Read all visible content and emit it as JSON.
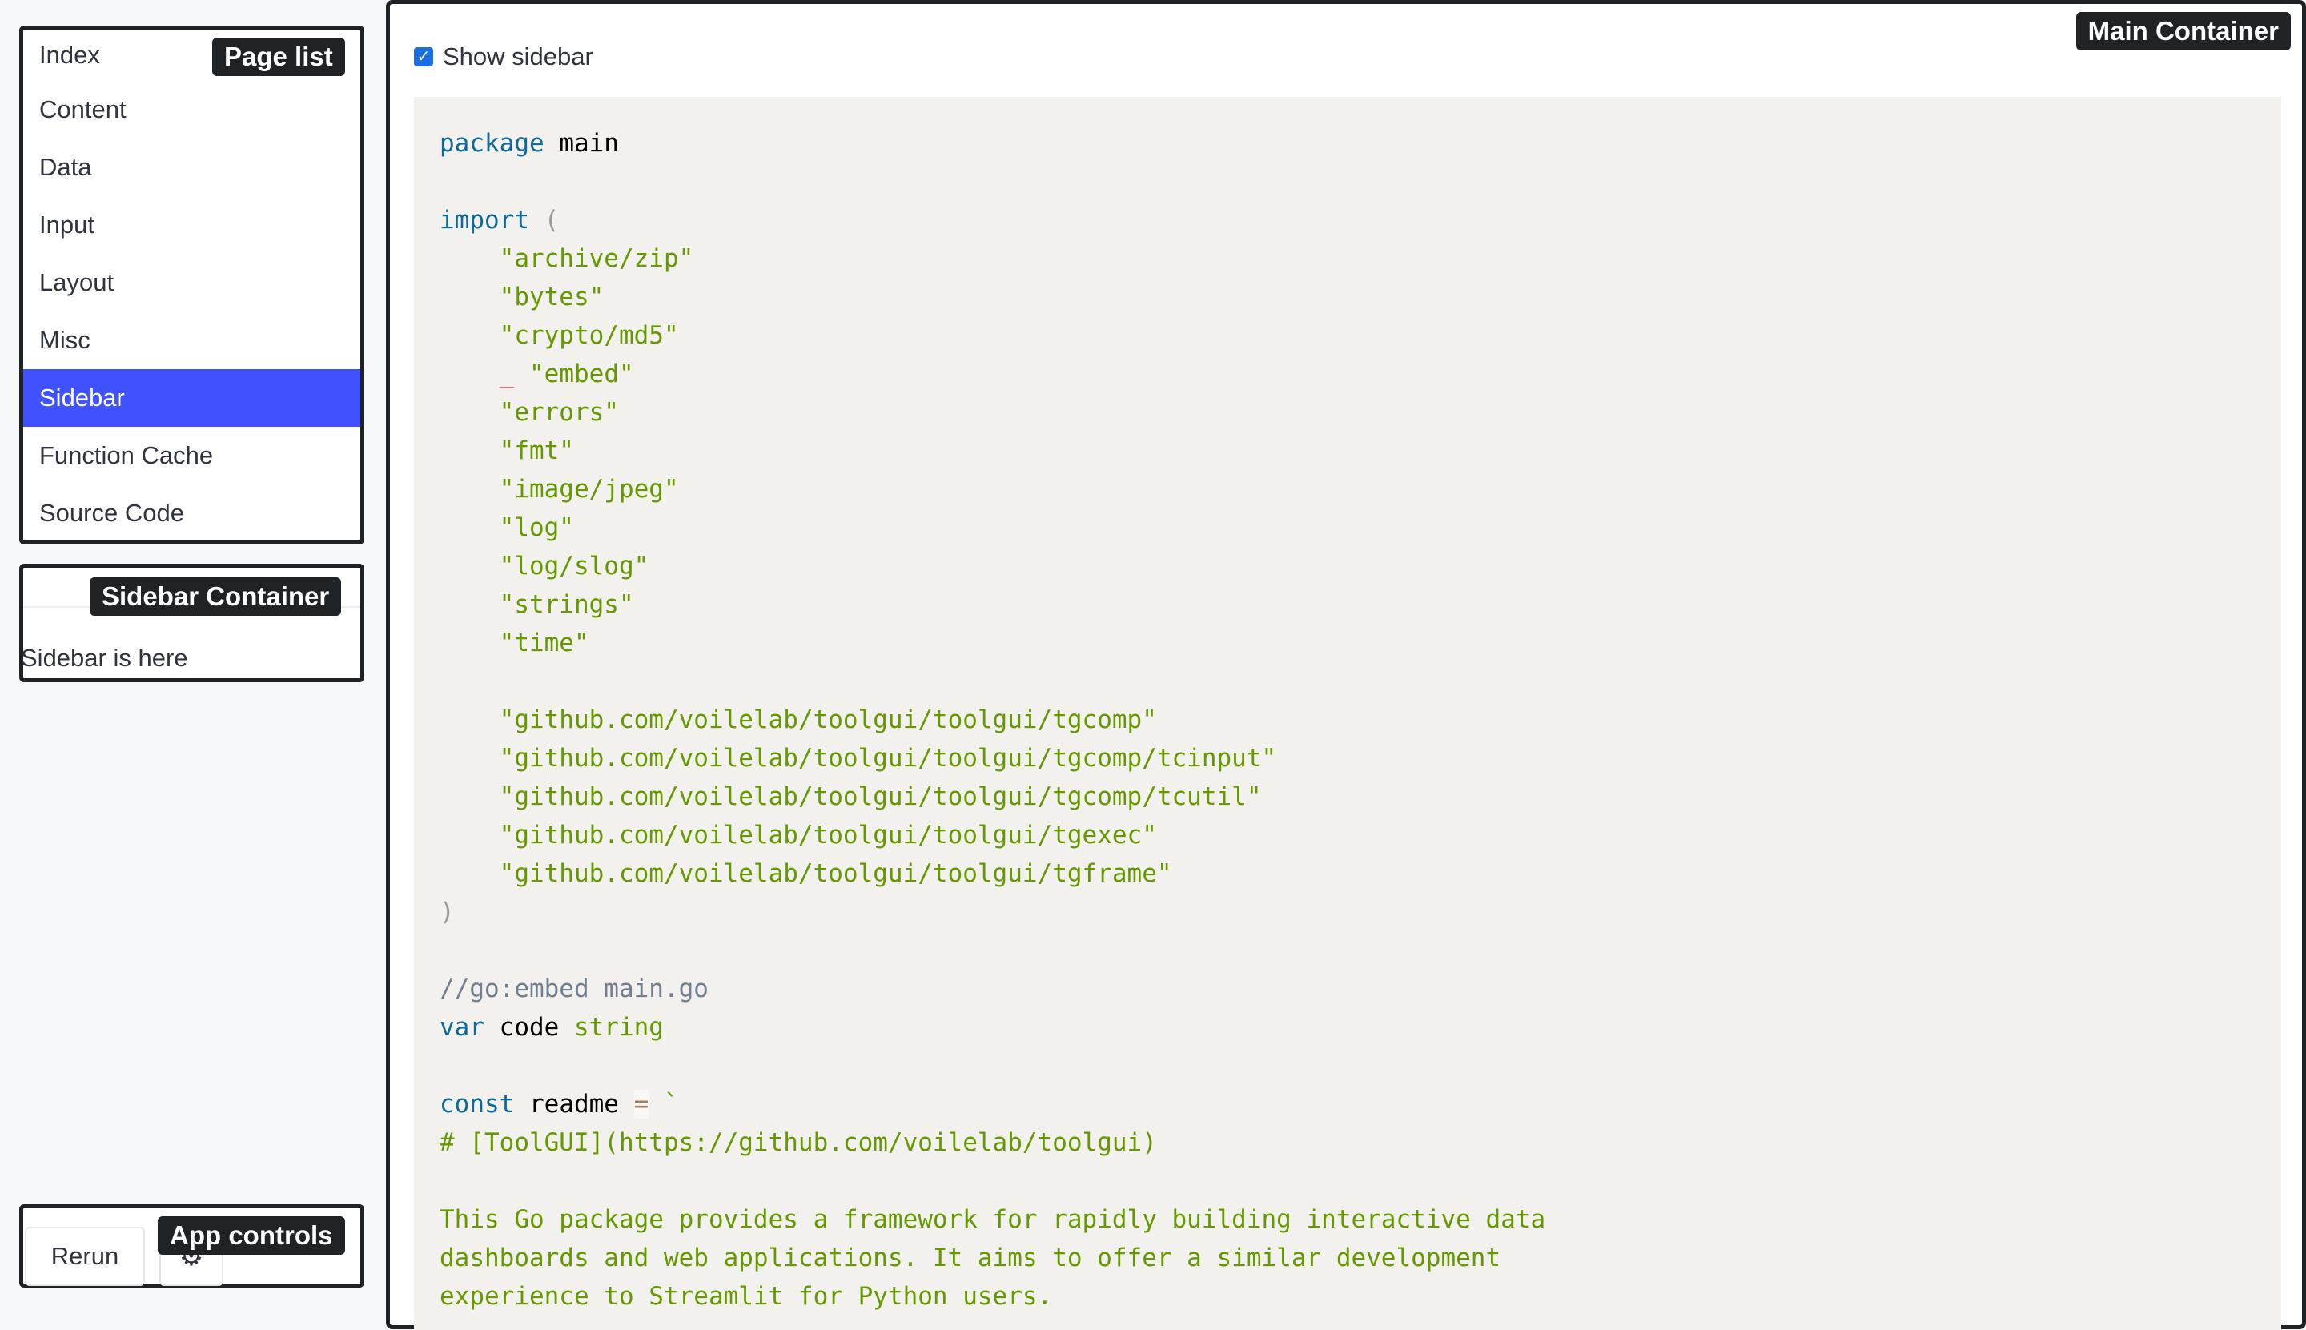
{
  "sidebar": {
    "page_list": {
      "tag": "Page list",
      "items": [
        {
          "label": "Index"
        },
        {
          "label": "Content"
        },
        {
          "label": "Data"
        },
        {
          "label": "Input"
        },
        {
          "label": "Layout"
        },
        {
          "label": "Misc"
        },
        {
          "label": "Sidebar",
          "active": true
        },
        {
          "label": "Function Cache"
        },
        {
          "label": "Source Code"
        }
      ]
    },
    "container": {
      "tag": "Sidebar Container",
      "text": "Sidebar is here"
    },
    "app_controls": {
      "tag": "App controls",
      "rerun_label": "Rerun",
      "settings_icon": "gear-icon"
    }
  },
  "main": {
    "tag": "Main Container",
    "show_sidebar": {
      "label": "Show sidebar",
      "checked": true
    },
    "code": [
      "package main",
      "",
      "import (",
      "\t\"archive/zip\"",
      "\t\"bytes\"",
      "\t\"crypto/md5\"",
      "\t_ \"embed\"",
      "\t\"errors\"",
      "\t\"fmt\"",
      "\t\"image/jpeg\"",
      "\t\"log\"",
      "\t\"log/slog\"",
      "\t\"strings\"",
      "\t\"time\"",
      "",
      "\t\"github.com/voilelab/toolgui/toolgui/tgcomp\"",
      "\t\"github.com/voilelab/toolgui/toolgui/tgcomp/tcinput\"",
      "\t\"github.com/voilelab/toolgui/toolgui/tgcomp/tcutil\"",
      "\t\"github.com/voilelab/toolgui/toolgui/tgexec\"",
      "\t\"github.com/voilelab/toolgui/toolgui/tgframe\"",
      ")",
      "",
      "//go:embed main.go",
      "var code string",
      "",
      "const readme = `",
      "# [ToolGUI](https://github.com/voilelab/toolgui)",
      "",
      "This Go package provides a framework for rapidly building interactive data",
      "dashboards and web applications. It aims to offer a similar development",
      "experience to Streamlit for Python users."
    ]
  },
  "colors": {
    "active_item_bg": "#4052ff",
    "tag_bg": "#1f2326",
    "code_bg": "#f3f1ee",
    "keyword": "#0f6a9c",
    "string": "#669900",
    "comment": "#708090",
    "checkbox": "#1a6fe0"
  }
}
